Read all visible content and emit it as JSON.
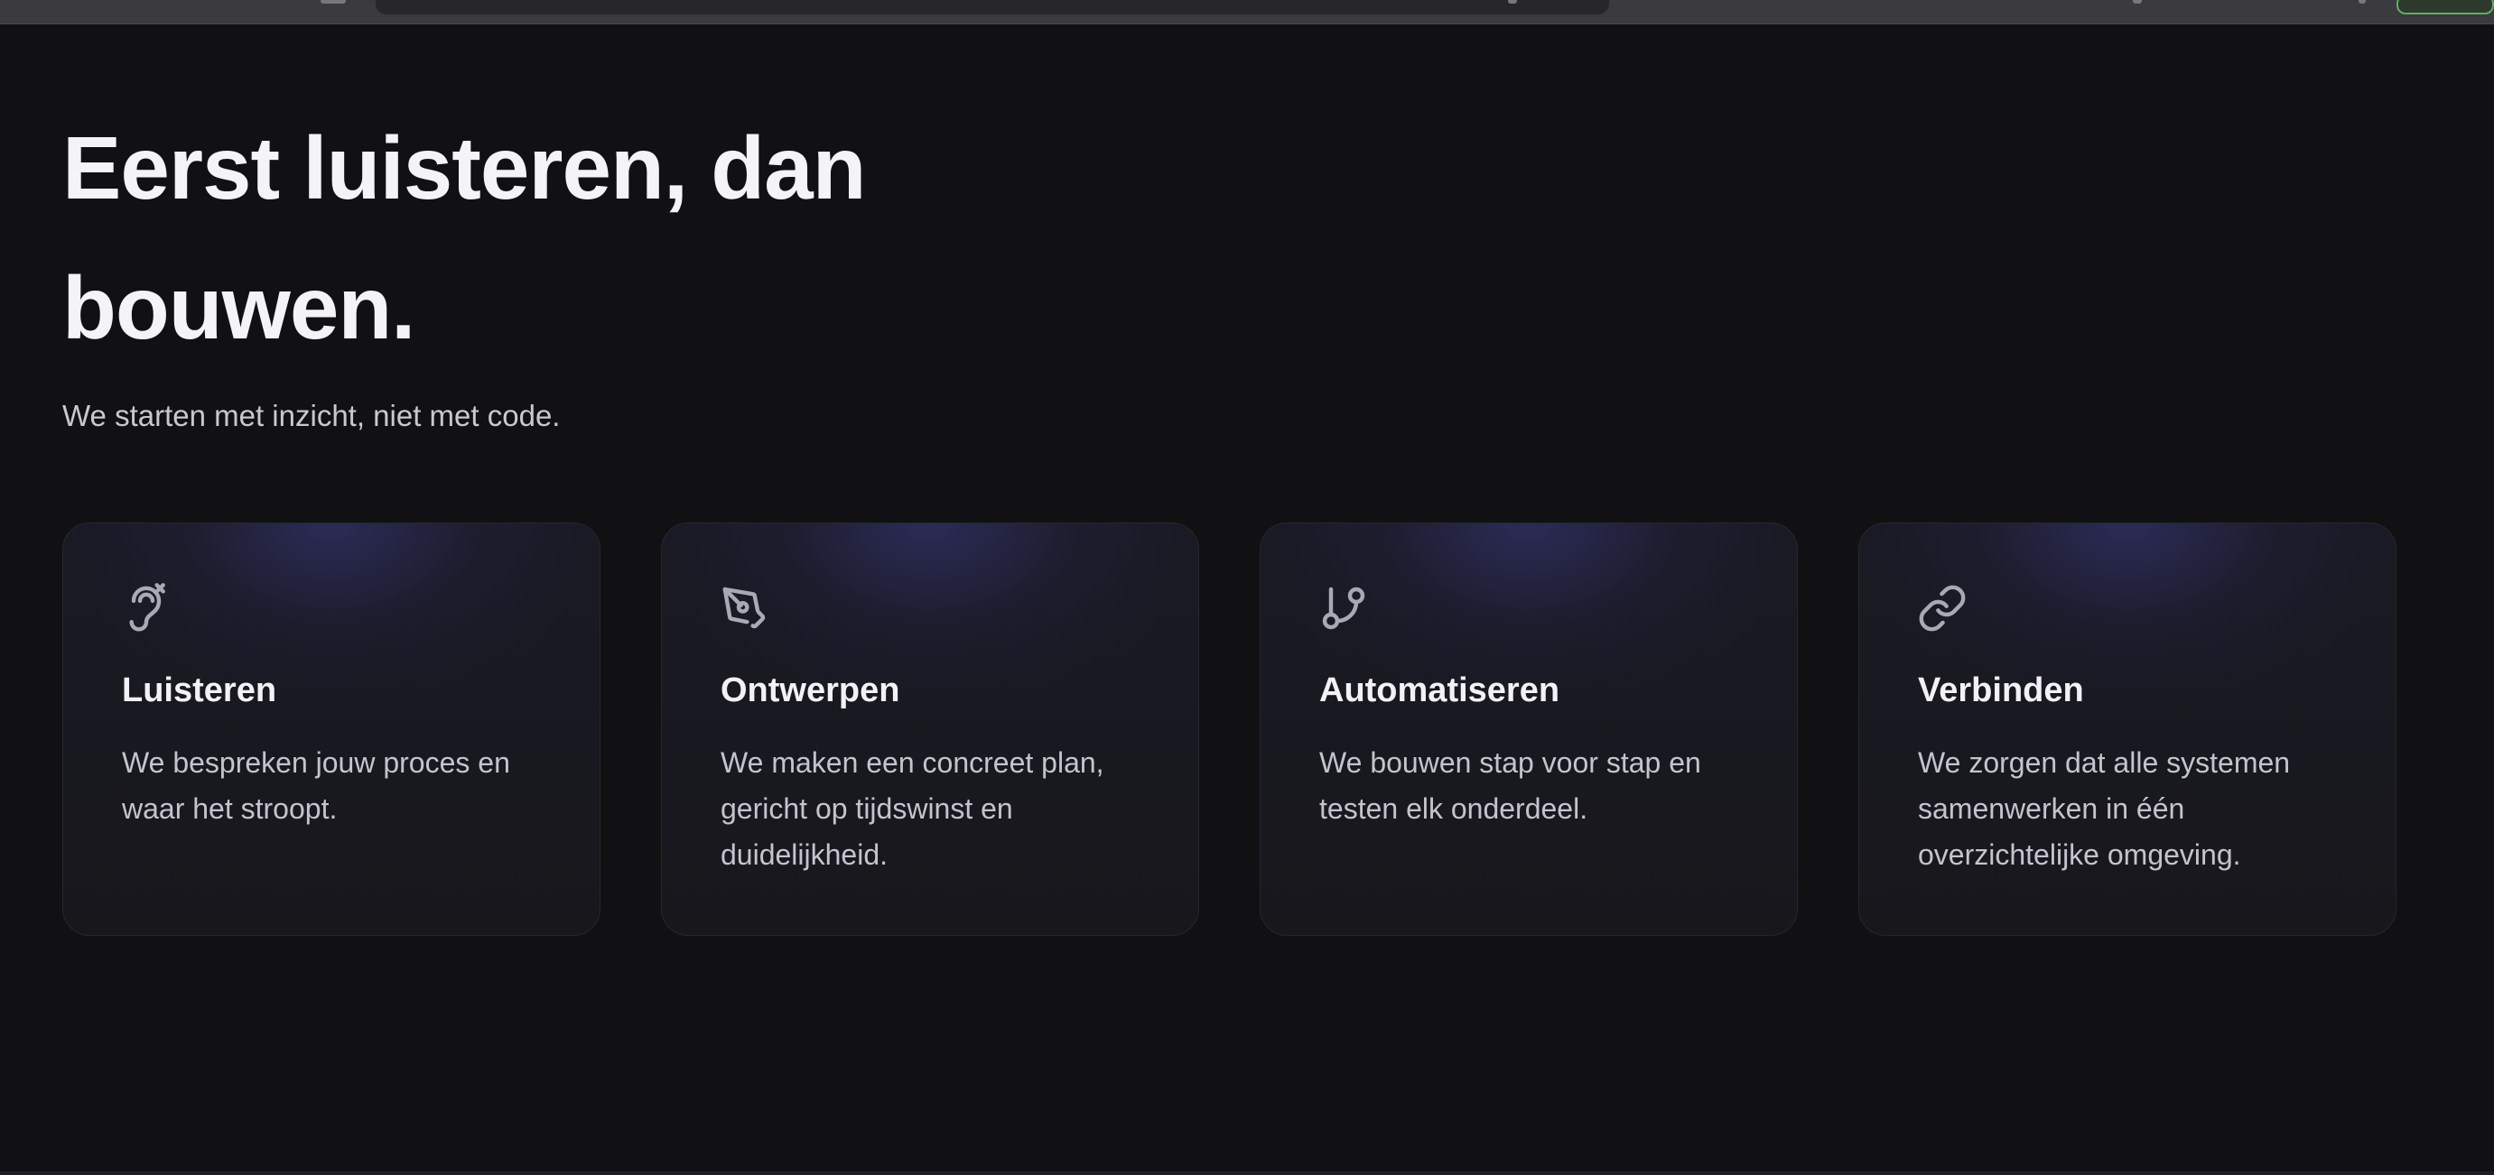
{
  "hero": {
    "title": "Eerst luisteren, dan bouwen.",
    "subtitle": "We starten met inzicht, niet met code."
  },
  "cards": [
    {
      "icon": "ear-icon",
      "title": "Luisteren",
      "text": "We bespreken jouw proces en waar het stroopt."
    },
    {
      "icon": "pen-tool-icon",
      "title": "Ontwerpen",
      "text": "We maken een concreet plan, gericht op tijdswinst en duidelijkheid."
    },
    {
      "icon": "git-branch-icon",
      "title": "Automatiseren",
      "text": "We bouwen stap voor stap en testen elk onderdeel."
    },
    {
      "icon": "link-icon",
      "title": "Verbinden",
      "text": "We zorgen dat alle systemen samenwerken in één overzichtelijke omgeving."
    }
  ],
  "colors": {
    "background": "#111114",
    "card_glow": "#3a3a82",
    "title": "#f4f4f7",
    "body_text": "#c4c4cc",
    "icon": "#a9a9b4"
  }
}
